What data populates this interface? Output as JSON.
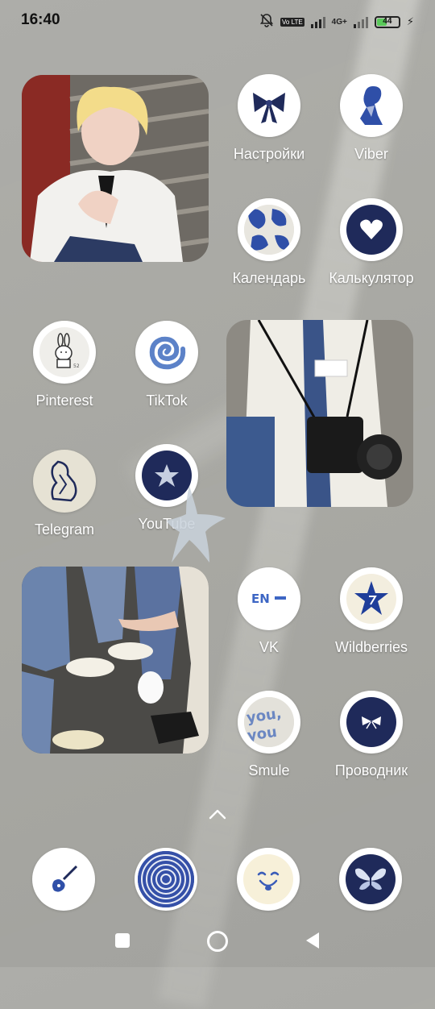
{
  "status_bar": {
    "time": "16:40",
    "battery_level": "44",
    "network_label": "4G+",
    "volte_label": "Vo LTE"
  },
  "widgets": [
    {
      "name": "photo-widget-boy",
      "desc": "photo"
    },
    {
      "name": "photo-widget-camera",
      "desc": "photo"
    },
    {
      "name": "photo-widget-legs",
      "desc": "photo"
    }
  ],
  "apps": {
    "settings": {
      "label": "Настройки",
      "icon": "bow-icon"
    },
    "viber": {
      "label": "Viber",
      "icon": "figure-icon"
    },
    "calendar": {
      "label": "Календарь",
      "icon": "pattern-icon"
    },
    "calculator": {
      "label": "Калькулятор",
      "icon": "heart-icon"
    },
    "pinterest": {
      "label": "Pinterest",
      "icon": "bunny-icon"
    },
    "tiktok": {
      "label": "TikTok",
      "icon": "spiral-icon"
    },
    "telegram": {
      "label": "Telegram",
      "icon": "sketch-icon"
    },
    "youtube": {
      "label": "YouTube",
      "icon": "star-icon"
    },
    "vk": {
      "label": "VK",
      "icon": "en-logo-icon",
      "icon_text": "EN-"
    },
    "wildberries": {
      "label": "Wildberries",
      "icon": "star-badge-icon"
    },
    "smule": {
      "label": "Smule",
      "icon": "you-text-icon",
      "icon_text": "you,\nyou"
    },
    "explorer": {
      "label": "Проводник",
      "icon": "small-bow-icon"
    }
  },
  "dock": [
    {
      "name": "dock-guitar",
      "icon": "guitar-icon"
    },
    {
      "name": "dock-spiral",
      "icon": "concentric-spiral-icon"
    },
    {
      "name": "dock-smiley",
      "icon": "smiley-icon"
    },
    {
      "name": "dock-butterfly",
      "icon": "butterfly-icon"
    }
  ],
  "colors": {
    "navy": "#1f2a5a",
    "blue": "#2f4fa8",
    "wallpaper": "#a9a9a4"
  }
}
